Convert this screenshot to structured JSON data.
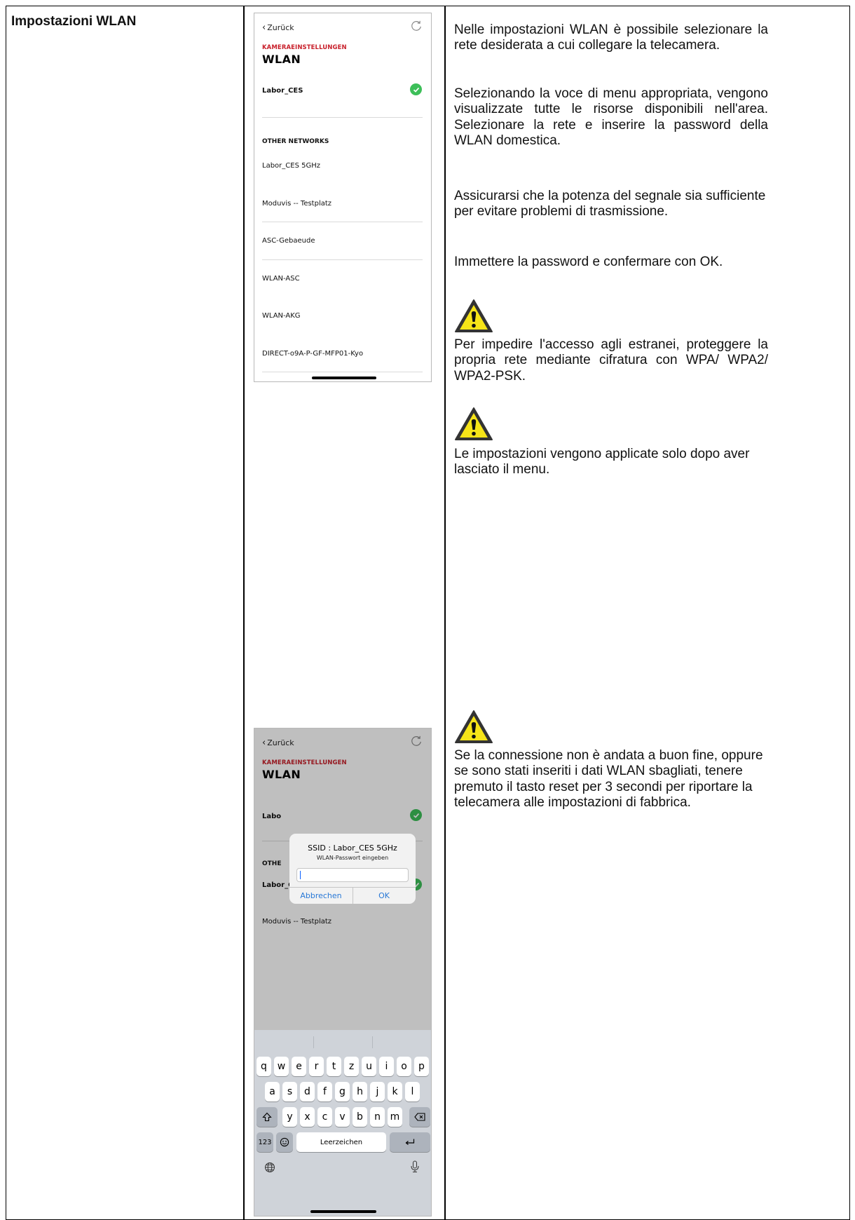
{
  "section": {
    "title": "Impostazioni WLAN"
  },
  "phone1": {
    "back_label": "Zurück",
    "breadcrumb": "KAMERAEINSTELLUNGEN",
    "title": "WLAN",
    "connected_network": "Labor_CES",
    "other_header": "OTHER NETWORKS",
    "networks": [
      "Labor_CES 5GHz",
      "Moduvis -- Testplatz",
      "ASC-Gebaeude",
      "WLAN-ASC",
      "WLAN-AKG",
      "DIRECT-o9A-P-GF-MFP01-Kyo"
    ]
  },
  "phone2": {
    "back_label": "Zurück",
    "breadcrumb": "KAMERAEINSTELLUNGEN",
    "title": "WLAN",
    "row1_partial": "Labo",
    "other_partial": "OTHE",
    "row_selected": "Labor_CES 5GHz",
    "row_next": "Moduvis -- Testplatz",
    "dialog": {
      "title": "SSID : Labor_CES 5GHz",
      "subtitle": "WLAN-Passwort eingeben",
      "cancel": "Abbrechen",
      "ok": "OK"
    },
    "keyboard": {
      "row1": [
        "q",
        "w",
        "e",
        "r",
        "t",
        "z",
        "u",
        "i",
        "o",
        "p"
      ],
      "row2": [
        "a",
        "s",
        "d",
        "f",
        "g",
        "h",
        "j",
        "k",
        "l"
      ],
      "row3": [
        "y",
        "x",
        "c",
        "v",
        "b",
        "n",
        "m"
      ],
      "numbers_key": "123",
      "space_label": "Leerzeichen"
    }
  },
  "text": {
    "p1": "Nelle impostazioni WLAN è possibile selezionare la rete desiderata a cui collegare la telecamera.",
    "p2": "Selezionando la voce di menu appropriata, vengono visualizzate tutte le risorse disponibili nell'area. Selezionare la rete e inserire la password della WLAN domestica.",
    "p3": "Assicurarsi che la potenza del segnale sia sufficiente per evitare problemi di trasmissione.",
    "p4": "Immettere la password e confermare con OK.",
    "warning1": "Per impedire l'accesso agli estranei, proteggere la propria rete mediante cifratura con WPA/ WPA2/ WPA2-PSK.",
    "warning2": "Le impostazioni vengono applicate solo dopo aver lasciato il menu.",
    "warning3": "Se la connessione non è andata a buon fine, oppure se sono stati inseriti i dati WLAN sbagliati, tenere premuto il tasto reset per 3 secondi per riportare la telecamera alle impostazioni di fabbrica."
  },
  "colors": {
    "accent_red": "#c8202b",
    "check_green": "#3dbf59",
    "link_blue": "#2878d6"
  },
  "icons": [
    "chevron-left-icon",
    "refresh-icon",
    "check-circle-icon",
    "warning-triangle-icon",
    "shift-icon",
    "backspace-icon",
    "emoji-icon",
    "return-icon",
    "globe-icon",
    "microphone-icon"
  ]
}
